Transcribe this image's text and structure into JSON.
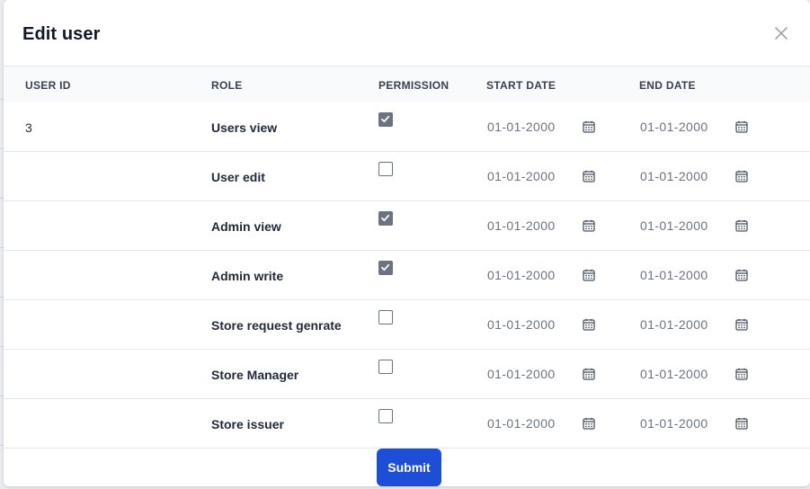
{
  "modal": {
    "title": "Edit user",
    "close_icon": "close-icon"
  },
  "table": {
    "headers": [
      "USER ID",
      "ROLE",
      "PERMISSION",
      "START DATE",
      "END DATE"
    ],
    "rows": [
      {
        "user_id": "3",
        "role": "Users view",
        "permission": true,
        "start_date": "01-01-2000",
        "end_date": "01-01-2000"
      },
      {
        "user_id": "",
        "role": "User edit",
        "permission": false,
        "start_date": "01-01-2000",
        "end_date": "01-01-2000"
      },
      {
        "user_id": "",
        "role": "Admin view",
        "permission": true,
        "start_date": "01-01-2000",
        "end_date": "01-01-2000"
      },
      {
        "user_id": "",
        "role": "Admin write",
        "permission": true,
        "start_date": "01-01-2000",
        "end_date": "01-01-2000"
      },
      {
        "user_id": "",
        "role": "Store request genrate",
        "permission": false,
        "start_date": "01-01-2000",
        "end_date": "01-01-2000"
      },
      {
        "user_id": "",
        "role": "Store Manager",
        "permission": false,
        "start_date": "01-01-2000",
        "end_date": "01-01-2000"
      },
      {
        "user_id": "",
        "role": "Store issuer",
        "permission": false,
        "start_date": "01-01-2000",
        "end_date": "01-01-2000"
      }
    ]
  },
  "footer": {
    "submit_label": "Submit"
  },
  "colors": {
    "primary": "#1d4ed8",
    "checkbox_checked": "#6b7280",
    "header_bg": "#f9fafb",
    "date_text": "#6b7280"
  },
  "icons": {
    "calendar": "calendar-icon",
    "check": "check-icon"
  }
}
